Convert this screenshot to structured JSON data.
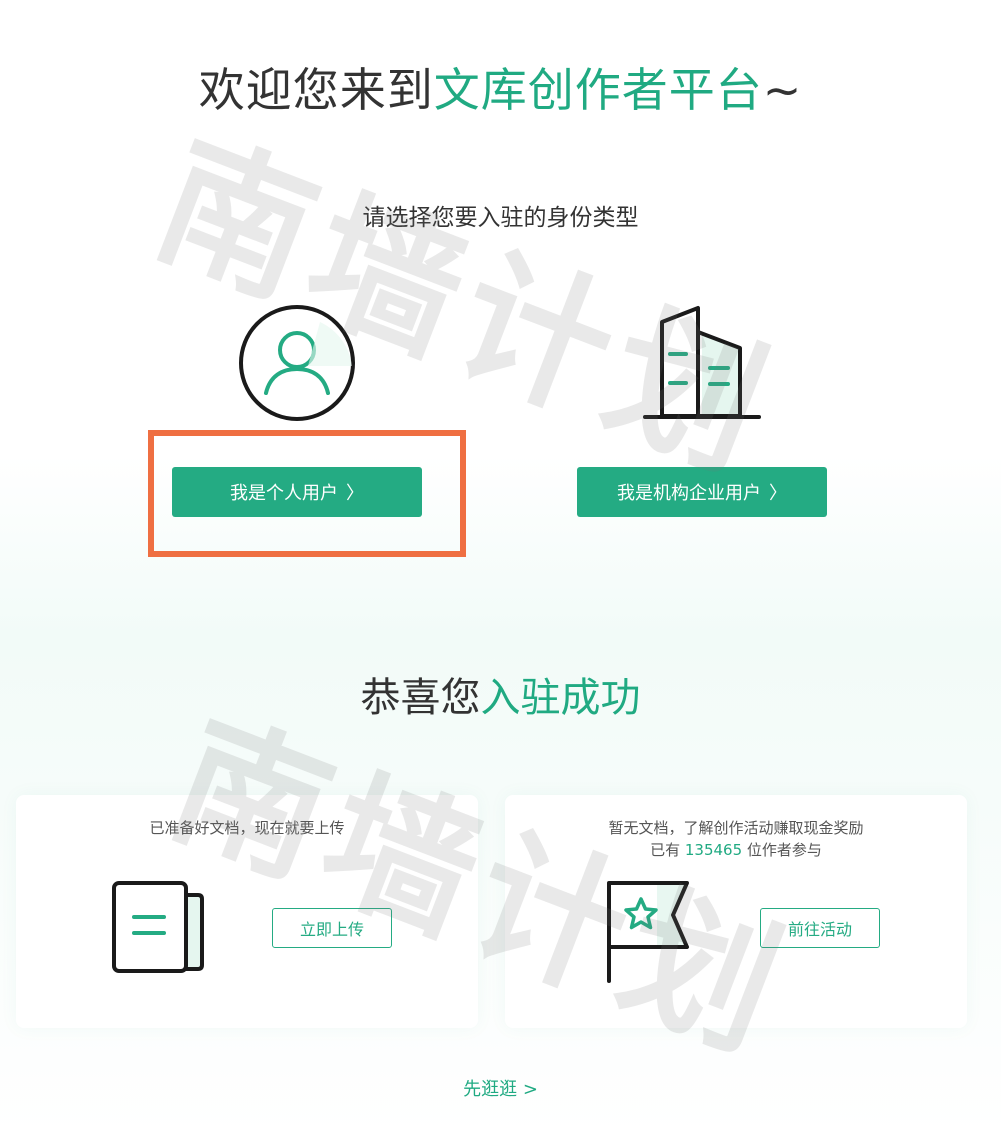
{
  "welcome": {
    "title_prefix": "欢迎您来到",
    "title_highlight": "文库创作者平台",
    "title_suffix": "~"
  },
  "identity": {
    "prompt": "请选择您要入驻的身份类型",
    "personal": {
      "label": "我是个人用户",
      "chevron": "〉",
      "icon": "user-avatar-icon"
    },
    "organization": {
      "label": "我是机构企业用户",
      "chevron": "〉",
      "icon": "building-icon"
    }
  },
  "success": {
    "title_prefix": "恭喜您",
    "title_highlight": "入驻成功"
  },
  "cards": {
    "upload": {
      "description": "已准备好文档，现在就要上传",
      "button_label": "立即上传",
      "icon": "document-icon"
    },
    "activity": {
      "description": "暂无文档，了解创作活动赚取现金奖励",
      "count_prefix": "已有",
      "count": "135465",
      "count_suffix": "位作者参与",
      "button_label": "前往活动",
      "icon": "star-flag-icon"
    }
  },
  "browse": {
    "label": "先逛逛",
    "chevron": ">"
  },
  "watermark": {
    "text": "南墙计划"
  },
  "colors": {
    "brand_green": "#24ab83",
    "highlight_orange": "#ef6f42",
    "text_dark": "#333333"
  }
}
